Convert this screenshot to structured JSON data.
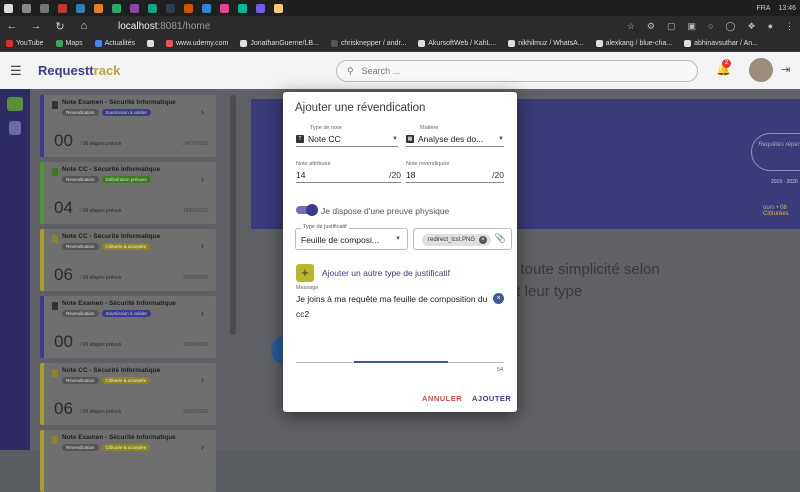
{
  "taskbar": {
    "lang": "FRA",
    "time": "13:46"
  },
  "browser": {
    "url_host": "localhost",
    "url_path": ":8081/home",
    "bookmarks": [
      "YouTube",
      "Maps",
      "Actualités",
      "www.udemy.com",
      "JonathanGuerne/LB...",
      "chrisknepper / andr...",
      "AkursoftWeb / KahL...",
      "nikhilmuz / WhatsA...",
      "alexkang / blue-cha...",
      "abhinavsuthar / An..."
    ]
  },
  "app": {
    "brand_a": "Request",
    "brand_b": "rack",
    "search_placeholder": "Search ...",
    "notif_count": "2"
  },
  "cards": [
    {
      "title": "Note Examen - Sécurité Informatique",
      "chip1": "Revendication",
      "chip2": "Soumission à valider",
      "num": "00",
      "sub": "/ 06 étapes prévus",
      "date": "24/07/2020"
    },
    {
      "title": "Note CC - Sécurité Informatique",
      "chip1": "Revendication",
      "chip2": "Délibération prévues",
      "num": "04",
      "sub": "/ 06 étapes prévus",
      "date": "18/07/2020"
    },
    {
      "title": "Note CC - Sécurité Informatique",
      "chip1": "Revendication",
      "chip2": "Clôturée & acceptée",
      "num": "06",
      "sub": "/ 06 étapes prévus",
      "date": "20/07/2020"
    },
    {
      "title": "Note Examen - Sécurité Informatique",
      "chip1": "Revendication",
      "chip2": "Soumission à valider",
      "num": "00",
      "sub": "/ 06 étapes prévus",
      "date": "10/06/2020"
    },
    {
      "title": "Note CC - Sécurité Informatique",
      "chip1": "Revendication",
      "chip2": "Clôturée & acceptée",
      "num": "06",
      "sub": "/ 06 étapes prévus",
      "date": "20/07/2020"
    },
    {
      "title": "Note Examen - Sécurité Informatique",
      "chip1": "Revendication",
      "chip2": "Clôturée & acceptée",
      "num": "",
      "sub": "",
      "date": ""
    }
  ],
  "background": {
    "pill": "Requêtes répertoriées",
    "year": "2019 - 2020",
    "links_a": "ours",
    "links_b": "08 Clôturées",
    "text_line1": "n toute simplicité selon",
    "text_line2": "et leur type"
  },
  "dialog": {
    "title": "Ajouter une révendication",
    "type_label": "Type de note",
    "type_value": "Note CC",
    "matiere_label": "Matière",
    "matiere_value": "Analyse des do...",
    "note_attr_label": "Note attribuée",
    "note_attr_value": "14",
    "note_attr_suffix": "/20",
    "note_rev_label": "Note revendiquée",
    "note_rev_value": "18",
    "note_rev_suffix": "/20",
    "toggle_label": "Je dispose d'une preuve physique",
    "justif_label": "Type de justificatif",
    "justif_value": "Feuille de composi...",
    "file_name": "redirect_lcst.PNG",
    "add_justif_label": "Ajouter un autre type de justificatif",
    "message_label": "Message",
    "message_value": "Je joins à ma requête ma feuille de composition du cc2",
    "counter": "54",
    "cancel_label": "ANNULER",
    "add_label": "AJOUTER"
  }
}
